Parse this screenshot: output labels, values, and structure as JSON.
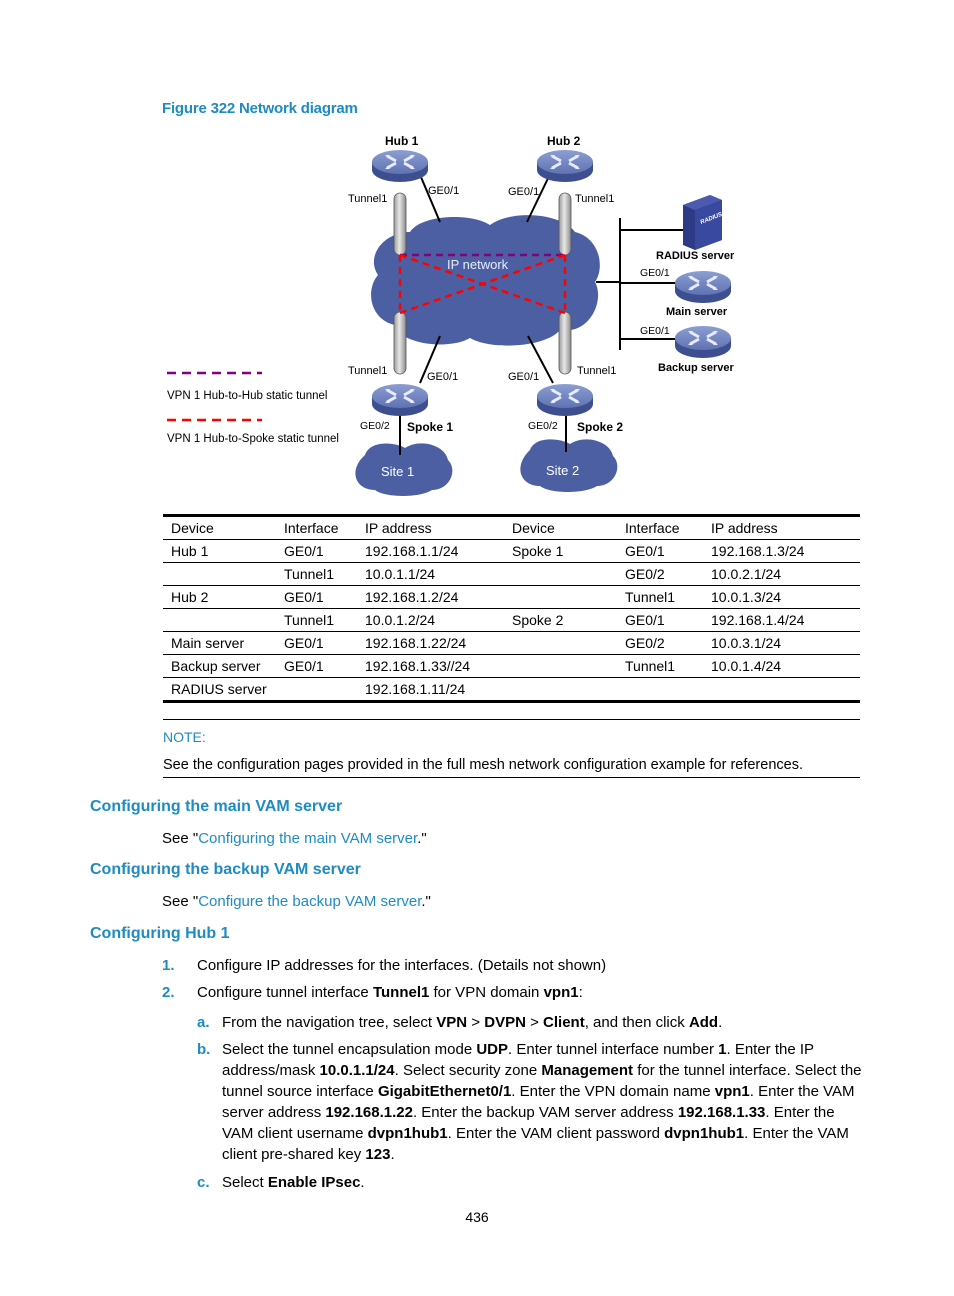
{
  "figure": {
    "title": "Figure 322 Network diagram",
    "labels": {
      "hub1": "Hub 1",
      "hub2": "Hub 2",
      "spoke1": "Spoke 1",
      "spoke2": "Spoke 2",
      "radius": "RADIUS server",
      "main": "Main server",
      "backup": "Backup server",
      "ip_network": "IP network",
      "site1": "Site 1",
      "site2": "Site 2",
      "tunnel1": "Tunnel1",
      "ge01": "GE0/1",
      "ge02": "GE0/2",
      "radius_logo": "RADIUS"
    },
    "legend": [
      {
        "label": "VPN 1 Hub-to-Hub  static tunnel",
        "color": "#800080"
      },
      {
        "label": "VPN 1 Hub-to-Spoke  static tunnel",
        "color": "#ff0000"
      }
    ],
    "colors": {
      "cloud": "#4d5fa3",
      "router": "#5a6fb0",
      "tunnel": "#c8c8c8"
    }
  },
  "table": {
    "headers": [
      "Device",
      "Interface",
      "IP address",
      "Device",
      "Interface",
      "IP address"
    ],
    "rows": [
      [
        "Hub 1",
        "GE0/1",
        "192.168.1.1/24",
        "Spoke 1",
        "GE0/1",
        "192.168.1.3/24"
      ],
      [
        "",
        "Tunnel1",
        "10.0.1.1/24",
        "",
        "GE0/2",
        "10.0.2.1/24"
      ],
      [
        "Hub 2",
        "GE0/1",
        "192.168.1.2/24",
        "",
        "Tunnel1",
        "10.0.1.3/24"
      ],
      [
        "",
        "Tunnel1",
        "10.0.1.2/24",
        "Spoke 2",
        "GE0/1",
        "192.168.1.4/24"
      ],
      [
        "Main server",
        "GE0/1",
        "192.168.1.22/24",
        "",
        "GE0/2",
        "10.0.3.1/24"
      ],
      [
        "Backup server",
        "GE0/1",
        "192.168.1.33//24",
        "",
        "Tunnel1",
        "10.0.1.4/24"
      ],
      [
        "RADIUS server",
        "",
        "192.168.1.11/24",
        "",
        "",
        ""
      ]
    ]
  },
  "note": {
    "label": "NOTE:",
    "text": "See the configuration pages provided in the full mesh network configuration example for references."
  },
  "sections": {
    "main_vam": {
      "heading": "Configuring the main VAM server",
      "see": "See \"",
      "link": "Configuring the main VAM server",
      "after": ".\""
    },
    "backup_vam": {
      "heading": "Configuring the backup VAM server",
      "see": "See \"",
      "link": "Configure the backup VAM server",
      "after": ".\""
    },
    "hub1": {
      "heading": "Configuring Hub 1",
      "step1": {
        "num": "1.",
        "text": "Configure IP addresses for the interfaces. (Details not shown)"
      },
      "step2": {
        "num": "2.",
        "t1": "Configure tunnel interface ",
        "b1": "Tunnel1",
        "t2": " for VPN domain ",
        "b2": "vpn1",
        "t3": ":"
      },
      "sub_a": {
        "num": "a.",
        "t1": "From the navigation tree, select ",
        "b1": "VPN",
        "t2": " > ",
        "b2": "DVPN",
        "t3": " > ",
        "b3": "Client",
        "t4": ", and then click ",
        "b4": "Add",
        "t5": "."
      },
      "sub_b": {
        "num": "b.",
        "parts": [
          [
            "Select the tunnel encapsulation mode ",
            false
          ],
          [
            "UDP",
            true
          ],
          [
            ". Enter tunnel interface number ",
            false
          ],
          [
            "1",
            true
          ],
          [
            ". Enter the IP address/mask ",
            false
          ],
          [
            "10.0.1.1/24",
            true
          ],
          [
            ". Select security zone ",
            false
          ],
          [
            "Management",
            true
          ],
          [
            " for the tunnel interface. Select the tunnel source interface ",
            false
          ],
          [
            "GigabitEthernet0/1",
            true
          ],
          [
            ". Enter the VPN domain name ",
            false
          ],
          [
            "vpn1",
            true
          ],
          [
            ". Enter the VAM server address ",
            false
          ],
          [
            "192.168.1.22",
            true
          ],
          [
            ". Enter the backup VAM server address ",
            false
          ],
          [
            "192.168.1.33",
            true
          ],
          [
            ". Enter the VAM client username ",
            false
          ],
          [
            "dvpn1hub1",
            true
          ],
          [
            ". Enter the VAM client password ",
            false
          ],
          [
            "dvpn1hub1",
            true
          ],
          [
            ". Enter the VAM client pre-shared key ",
            false
          ],
          [
            "123",
            true
          ],
          [
            ".",
            false
          ]
        ]
      },
      "sub_c": {
        "num": "c.",
        "t1": "Select ",
        "b1": "Enable IPsec",
        "t2": "."
      }
    }
  },
  "page_number": "436"
}
